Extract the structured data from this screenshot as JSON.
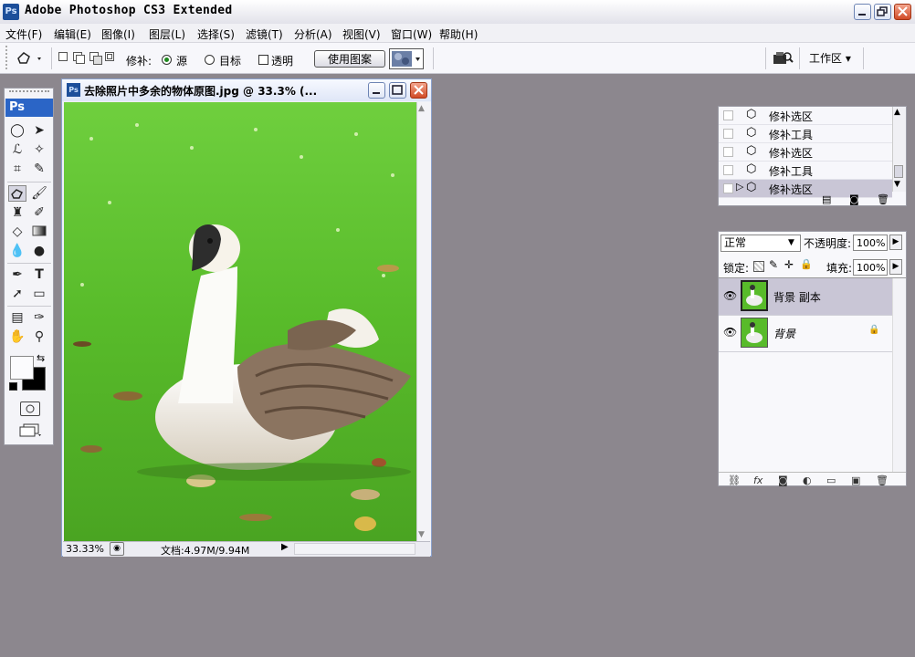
{
  "app": {
    "title": "Adobe Photoshop CS3 Extended",
    "icon": "Ps"
  },
  "menu": [
    {
      "label": "文件(F)"
    },
    {
      "label": "编辑(E)"
    },
    {
      "label": "图像(I)"
    },
    {
      "label": "图层(L)"
    },
    {
      "label": "选择(S)"
    },
    {
      "label": "滤镜(T)"
    },
    {
      "label": "分析(A)"
    },
    {
      "label": "视图(V)"
    },
    {
      "label": "窗口(W)"
    },
    {
      "label": "帮助(H)"
    }
  ],
  "options": {
    "patch_label": "修补:",
    "source_label": "源",
    "target_label": "目标",
    "transparent_label": "透明",
    "use_pattern_label": "使用图案",
    "workspace_label": "工作区 ▾"
  },
  "toolbox": {
    "header": "Ps"
  },
  "document": {
    "title": "去除照片中多余的物体原图.jpg @ 33.3% (...",
    "zoom": "33.33%",
    "doc_size": "文档:4.97M/9.94M"
  },
  "history": {
    "items": [
      {
        "label": "修补选区"
      },
      {
        "label": "修补工具"
      },
      {
        "label": "修补选区"
      },
      {
        "label": "修补工具"
      },
      {
        "label": "修补选区"
      }
    ]
  },
  "layers": {
    "blend_mode": "正常",
    "opacity_label": "不透明度:",
    "opacity_value": "100%",
    "lock_label": "锁定:",
    "fill_label": "填充:",
    "fill_value": "100%",
    "items": [
      {
        "name": "背景 副本"
      },
      {
        "name": "背景"
      }
    ]
  },
  "colors": {
    "accent": "#2b65c6",
    "background": "#8c878e",
    "active_row": "#c9c6d6"
  }
}
